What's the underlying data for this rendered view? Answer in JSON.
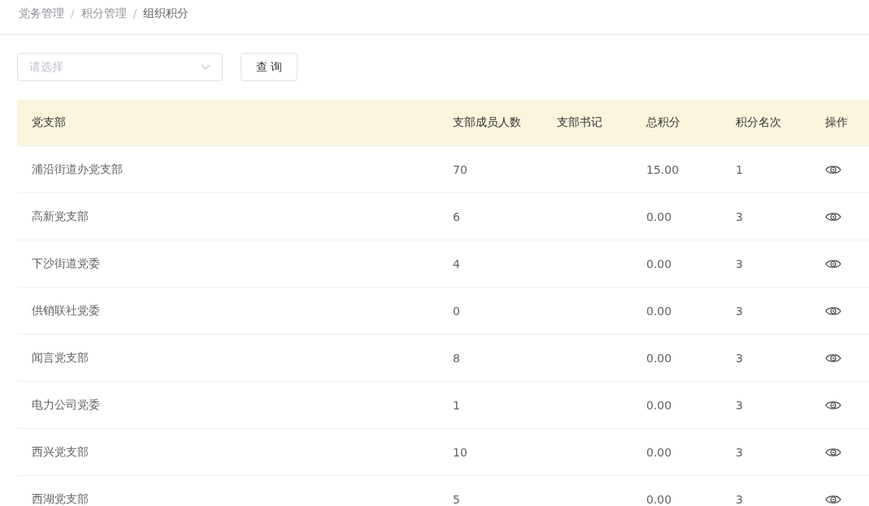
{
  "breadcrumb_separators": [
    "/",
    "/"
  ],
  "breadcrumb": [
    {
      "label": "党务管理",
      "current": false
    },
    {
      "label": "积分管理",
      "current": false
    },
    {
      "label": "组织积分",
      "current": true
    }
  ],
  "filter": {
    "placeholder": "请选择",
    "button": "查 询"
  },
  "table": {
    "columns": [
      "党支部",
      "支部成员人数",
      "支部书记",
      "总积分",
      "积分名次",
      "操作"
    ],
    "rows": [
      {
        "name": "浦沿街道办党支部",
        "members": "70",
        "total": "15.00",
        "rank": "1"
      },
      {
        "name": "高新党支部",
        "members": "6",
        "total": "0.00",
        "rank": "3"
      },
      {
        "name": "下沙街道党委",
        "members": "4",
        "total": "0.00",
        "rank": "3"
      },
      {
        "name": "供销联社党委",
        "members": "0",
        "total": "0.00",
        "rank": "3"
      },
      {
        "name": "闻言党支部",
        "members": "8",
        "total": "0.00",
        "rank": "3"
      },
      {
        "name": "电力公司党委",
        "members": "1",
        "total": "0.00",
        "rank": "3"
      },
      {
        "name": "西兴党支部",
        "members": "10",
        "total": "0.00",
        "rank": "3"
      },
      {
        "name": "西湖党支部",
        "members": "5",
        "total": "0.00",
        "rank": "3"
      }
    ]
  }
}
